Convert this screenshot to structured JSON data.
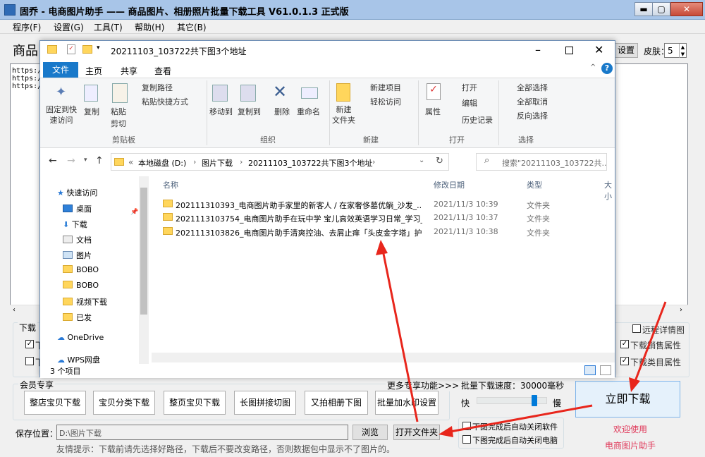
{
  "app": {
    "title": "固乔 - 电商图片助手 —— 商品图片、相册照片批量下载工具 V61.0.1.3 正式版",
    "window_buttons": {
      "minimize": "▬",
      "maximize": "▢",
      "close": "✕"
    }
  },
  "menu": [
    "程序(F)",
    "设置(G)",
    "工具(T)",
    "帮助(H)",
    "其它(B)"
  ],
  "top": {
    "label": "商品",
    "settings_label": "设置",
    "skin_label": "皮肤：",
    "skin_value": "5"
  },
  "url_lines": [
    "https:/",
    "https:/",
    "https:/"
  ],
  "download_group_label": "下载",
  "download_checks": [
    "下",
    "下"
  ],
  "right_options": {
    "detail_image": "远程详情图",
    "sales_attr": "下载销售属性",
    "category_attr": "下载类目属性"
  },
  "member": {
    "label": "会员专享",
    "more": "更多专享功能>>>",
    "buttons": [
      "整店宝贝下载",
      "宝贝分类下载",
      "整页宝贝下载",
      "长图拼接切图",
      "又拍相册下图",
      "批量加水印设置"
    ]
  },
  "speed": {
    "label": "批量下载速度：30000毫秒",
    "fast": "快",
    "slow": "慢",
    "value_fraction": 0.85
  },
  "options": {
    "close_software": "下图完成后自动关闭软件",
    "shutdown": "下图完成后自动关闭电脑"
  },
  "start_label": "立即下载",
  "welcome": [
    "欢迎使用",
    "电商图片助手"
  ],
  "save": {
    "label": "保存位置：",
    "path": "D:\\图片下载",
    "browse": "浏览",
    "open_folder": "打开文件夹"
  },
  "tip": "友情提示：下载前请先选择好路径，下载后不要改变路径，否则数据包中显示不了图片的。",
  "explorer": {
    "title": "20211103_103722共下图3个地址",
    "tabs": [
      "文件",
      "主页",
      "共享",
      "查看"
    ],
    "ribbon": {
      "pin": "固定到快\n速访问",
      "copy": "复制",
      "paste": "粘贴",
      "copy_path": "复制路径",
      "paste_shortcut": "粘贴快捷方式",
      "cut": "剪切",
      "move_to": "移动到",
      "copy_to": "复制到",
      "delete": "删除",
      "rename": "重命名",
      "new_folder": "新建\n文件夹",
      "new_item": "新建项目",
      "easy_access": "轻松访问",
      "properties": "属性",
      "open": "打开",
      "edit": "编辑",
      "history": "历史记录",
      "select_all": "全部选择",
      "select_none": "全部取消",
      "invert": "反向选择",
      "groups": [
        "剪贴板",
        "组织",
        "新建",
        "打开",
        "选择"
      ]
    },
    "address": [
      "本地磁盘 (D:)",
      "图片下载",
      "20211103_103722共下图3个地址"
    ],
    "search_placeholder": "搜索\"20211103_103722共...",
    "nav": [
      "快速访问",
      "桌面",
      "下载",
      "文档",
      "图片",
      "BOBO",
      "BOBO",
      "视频下载",
      "已发",
      "OneDrive",
      "WPS网盘"
    ],
    "columns": [
      "名称",
      "修改日期",
      "类型",
      "大小"
    ],
    "files": [
      {
        "name": "202111310393_电商图片助手家里的新客人 / 在家奢侈墓优躺_沙发_...",
        "date": "2021/11/3 10:39",
        "type": "文件夹"
      },
      {
        "name": "2021113103754_电商图片助手在玩中学 宝儿高效英语学习日常_学习_...",
        "date": "2021/11/3 10:37",
        "type": "文件夹"
      },
      {
        "name": "2021113103826_电商图片助手清爽控油、去屑止痒「头皮金字塔」护...",
        "date": "2021/11/3 10:38",
        "type": "文件夹"
      }
    ],
    "status": "3 个项目"
  }
}
